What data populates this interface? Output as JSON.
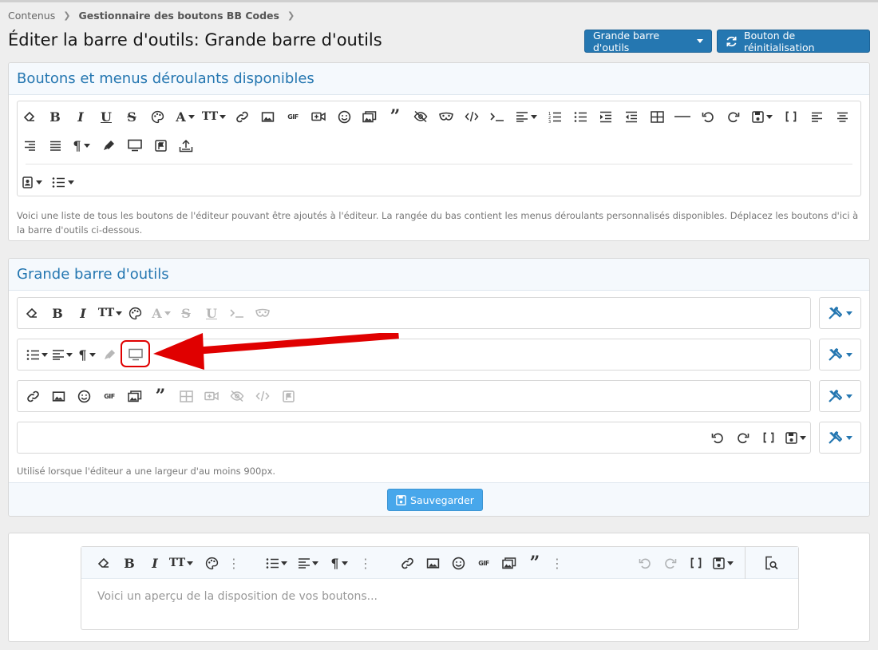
{
  "breadcrumb": {
    "items": [
      "Contenus",
      "Gestionnaire des boutons BB Codes"
    ]
  },
  "page": {
    "title": "Éditer la barre d'outils: Grande barre d'outils"
  },
  "header_buttons": {
    "toolbar_select": "Grande barre d'outils",
    "reset": "Bouton de réinitialisation"
  },
  "available": {
    "title": "Boutons et menus déroulants disponibles",
    "description": "Voici une liste de tous les boutons de l'éditeur pouvant être ajoutés à l'éditeur. La rangée du bas contient les menus déroulants personnalisés disponibles. Déplacez les boutons d'ici à la barre d'outils ci-dessous."
  },
  "toolbar_section": {
    "title": "Grande barre d'outils",
    "hint": "Utilisé lorsque l'éditeur a une largeur d'au moins 900px.",
    "save_label": "Sauvegarder"
  },
  "preview": {
    "placeholder": "Voici un aperçu de la disposition de vos boutons..."
  },
  "icons": {
    "mini_gif": "GIF"
  },
  "colors": {
    "accent": "#2577b1",
    "save": "#47a7eb",
    "annotation": "#e00000"
  }
}
